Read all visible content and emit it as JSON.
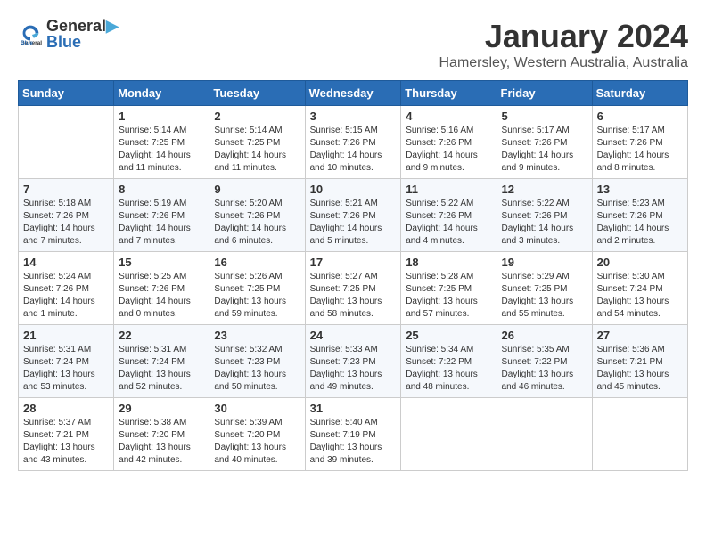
{
  "header": {
    "logo": {
      "general": "General",
      "blue": "Blue"
    },
    "title": "January 2024",
    "location": "Hamersley, Western Australia, Australia"
  },
  "calendar": {
    "days": [
      "Sunday",
      "Monday",
      "Tuesday",
      "Wednesday",
      "Thursday",
      "Friday",
      "Saturday"
    ],
    "weeks": [
      [
        {
          "day": "",
          "info": ""
        },
        {
          "day": "1",
          "info": "Sunrise: 5:14 AM\nSunset: 7:25 PM\nDaylight: 14 hours\nand 11 minutes."
        },
        {
          "day": "2",
          "info": "Sunrise: 5:14 AM\nSunset: 7:25 PM\nDaylight: 14 hours\nand 11 minutes."
        },
        {
          "day": "3",
          "info": "Sunrise: 5:15 AM\nSunset: 7:26 PM\nDaylight: 14 hours\nand 10 minutes."
        },
        {
          "day": "4",
          "info": "Sunrise: 5:16 AM\nSunset: 7:26 PM\nDaylight: 14 hours\nand 9 minutes."
        },
        {
          "day": "5",
          "info": "Sunrise: 5:17 AM\nSunset: 7:26 PM\nDaylight: 14 hours\nand 9 minutes."
        },
        {
          "day": "6",
          "info": "Sunrise: 5:17 AM\nSunset: 7:26 PM\nDaylight: 14 hours\nand 8 minutes."
        }
      ],
      [
        {
          "day": "7",
          "info": "Sunrise: 5:18 AM\nSunset: 7:26 PM\nDaylight: 14 hours\nand 7 minutes."
        },
        {
          "day": "8",
          "info": "Sunrise: 5:19 AM\nSunset: 7:26 PM\nDaylight: 14 hours\nand 7 minutes."
        },
        {
          "day": "9",
          "info": "Sunrise: 5:20 AM\nSunset: 7:26 PM\nDaylight: 14 hours\nand 6 minutes."
        },
        {
          "day": "10",
          "info": "Sunrise: 5:21 AM\nSunset: 7:26 PM\nDaylight: 14 hours\nand 5 minutes."
        },
        {
          "day": "11",
          "info": "Sunrise: 5:22 AM\nSunset: 7:26 PM\nDaylight: 14 hours\nand 4 minutes."
        },
        {
          "day": "12",
          "info": "Sunrise: 5:22 AM\nSunset: 7:26 PM\nDaylight: 14 hours\nand 3 minutes."
        },
        {
          "day": "13",
          "info": "Sunrise: 5:23 AM\nSunset: 7:26 PM\nDaylight: 14 hours\nand 2 minutes."
        }
      ],
      [
        {
          "day": "14",
          "info": "Sunrise: 5:24 AM\nSunset: 7:26 PM\nDaylight: 14 hours\nand 1 minute."
        },
        {
          "day": "15",
          "info": "Sunrise: 5:25 AM\nSunset: 7:26 PM\nDaylight: 14 hours\nand 0 minutes."
        },
        {
          "day": "16",
          "info": "Sunrise: 5:26 AM\nSunset: 7:25 PM\nDaylight: 13 hours\nand 59 minutes."
        },
        {
          "day": "17",
          "info": "Sunrise: 5:27 AM\nSunset: 7:25 PM\nDaylight: 13 hours\nand 58 minutes."
        },
        {
          "day": "18",
          "info": "Sunrise: 5:28 AM\nSunset: 7:25 PM\nDaylight: 13 hours\nand 57 minutes."
        },
        {
          "day": "19",
          "info": "Sunrise: 5:29 AM\nSunset: 7:25 PM\nDaylight: 13 hours\nand 55 minutes."
        },
        {
          "day": "20",
          "info": "Sunrise: 5:30 AM\nSunset: 7:24 PM\nDaylight: 13 hours\nand 54 minutes."
        }
      ],
      [
        {
          "day": "21",
          "info": "Sunrise: 5:31 AM\nSunset: 7:24 PM\nDaylight: 13 hours\nand 53 minutes."
        },
        {
          "day": "22",
          "info": "Sunrise: 5:31 AM\nSunset: 7:24 PM\nDaylight: 13 hours\nand 52 minutes."
        },
        {
          "day": "23",
          "info": "Sunrise: 5:32 AM\nSunset: 7:23 PM\nDaylight: 13 hours\nand 50 minutes."
        },
        {
          "day": "24",
          "info": "Sunrise: 5:33 AM\nSunset: 7:23 PM\nDaylight: 13 hours\nand 49 minutes."
        },
        {
          "day": "25",
          "info": "Sunrise: 5:34 AM\nSunset: 7:22 PM\nDaylight: 13 hours\nand 48 minutes."
        },
        {
          "day": "26",
          "info": "Sunrise: 5:35 AM\nSunset: 7:22 PM\nDaylight: 13 hours\nand 46 minutes."
        },
        {
          "day": "27",
          "info": "Sunrise: 5:36 AM\nSunset: 7:21 PM\nDaylight: 13 hours\nand 45 minutes."
        }
      ],
      [
        {
          "day": "28",
          "info": "Sunrise: 5:37 AM\nSunset: 7:21 PM\nDaylight: 13 hours\nand 43 minutes."
        },
        {
          "day": "29",
          "info": "Sunrise: 5:38 AM\nSunset: 7:20 PM\nDaylight: 13 hours\nand 42 minutes."
        },
        {
          "day": "30",
          "info": "Sunrise: 5:39 AM\nSunset: 7:20 PM\nDaylight: 13 hours\nand 40 minutes."
        },
        {
          "day": "31",
          "info": "Sunrise: 5:40 AM\nSunset: 7:19 PM\nDaylight: 13 hours\nand 39 minutes."
        },
        {
          "day": "",
          "info": ""
        },
        {
          "day": "",
          "info": ""
        },
        {
          "day": "",
          "info": ""
        }
      ]
    ]
  }
}
